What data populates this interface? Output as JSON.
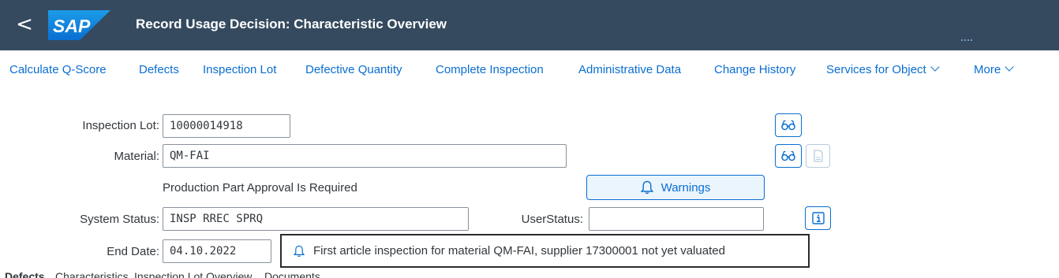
{
  "shell": {
    "back_symbol": "<",
    "logo_text": "SAP",
    "title": "Record Usage Decision: Characteristic Overview"
  },
  "toolbar": {
    "items": [
      "Calculate Q-Score",
      "Defects",
      "Inspection Lot",
      "Defective Quantity",
      "Complete Inspection",
      "Administrative Data",
      "Change History",
      "Services for Object",
      "More"
    ]
  },
  "form": {
    "inspection_lot_label": "Inspection Lot:",
    "inspection_lot_value": "10000014918",
    "material_label": "Material:",
    "material_value": "QM-FAI",
    "ppap_text": "Production Part Approval Is Required",
    "warnings_label": "Warnings",
    "system_status_label": "System Status:",
    "system_status_value": "INSP RREC SPRQ",
    "user_status_label": "UserStatus:",
    "user_status_value": "",
    "end_date_label": "End Date:",
    "end_date_value": "04.10.2022"
  },
  "message": {
    "text": "First article inspection for material QM-FAI, supplier 17300001 not yet valuated"
  },
  "bottom_tabs": [
    "Defects",
    "Characteristics",
    "Inspection Lot Overview",
    "Documents"
  ],
  "icons": {
    "display": "glasses-icon",
    "document": "document-icon",
    "info": "info-icon",
    "bell": "bell-icon"
  },
  "colors": {
    "shell_bg": "#354a5f",
    "accent": "#0a6ed1",
    "sap_logo": "#0a6ed1",
    "warnings_bg": "#ebf5fe"
  }
}
